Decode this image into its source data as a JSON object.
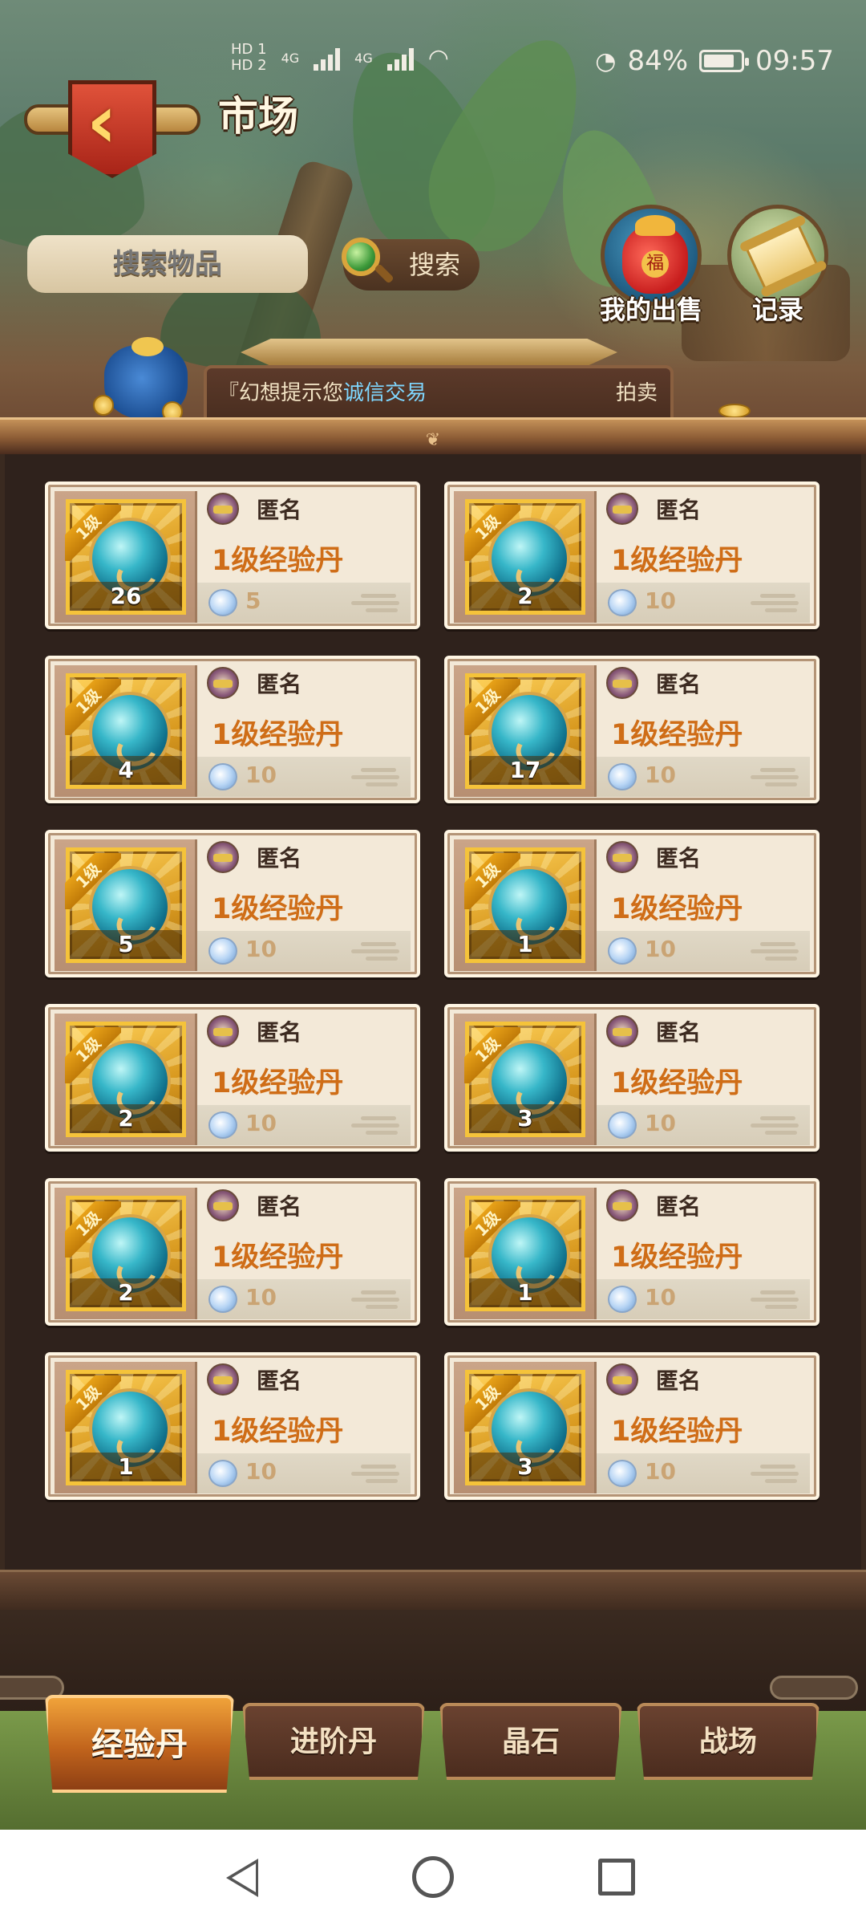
{
  "status_bar": {
    "hd1": "HD 1",
    "hd2": "HD 2",
    "net1": "4G",
    "net2": "4G",
    "battery_percent": "84%",
    "battery_level": 0.84,
    "time": "09:57"
  },
  "header": {
    "title": "市场",
    "back_icon": "chevron-left-icon"
  },
  "search": {
    "placeholder": "搜索物品",
    "button_label": "搜索"
  },
  "actions": {
    "my_sales": "我的出售",
    "records": "记录"
  },
  "notice": {
    "prefix": "『幻想提示您",
    "highlight": "诚信交易",
    "tail": "拍卖"
  },
  "items": [
    {
      "level_tag": "1级",
      "seller": "匿名",
      "name": "1级经验丹",
      "count": "26",
      "price": "5"
    },
    {
      "level_tag": "1级",
      "seller": "匿名",
      "name": "1级经验丹",
      "count": "2",
      "price": "10"
    },
    {
      "level_tag": "1级",
      "seller": "匿名",
      "name": "1级经验丹",
      "count": "4",
      "price": "10"
    },
    {
      "level_tag": "1级",
      "seller": "匿名",
      "name": "1级经验丹",
      "count": "17",
      "price": "10"
    },
    {
      "level_tag": "1级",
      "seller": "匿名",
      "name": "1级经验丹",
      "count": "5",
      "price": "10"
    },
    {
      "level_tag": "1级",
      "seller": "匿名",
      "name": "1级经验丹",
      "count": "1",
      "price": "10"
    },
    {
      "level_tag": "1级",
      "seller": "匿名",
      "name": "1级经验丹",
      "count": "2",
      "price": "10"
    },
    {
      "level_tag": "1级",
      "seller": "匿名",
      "name": "1级经验丹",
      "count": "3",
      "price": "10"
    },
    {
      "level_tag": "1级",
      "seller": "匿名",
      "name": "1级经验丹",
      "count": "2",
      "price": "10"
    },
    {
      "level_tag": "1级",
      "seller": "匿名",
      "name": "1级经验丹",
      "count": "1",
      "price": "10"
    },
    {
      "level_tag": "1级",
      "seller": "匿名",
      "name": "1级经验丹",
      "count": "1",
      "price": "10"
    },
    {
      "level_tag": "1级",
      "seller": "匿名",
      "name": "1级经验丹",
      "count": "3",
      "price": "10"
    }
  ],
  "tabs": [
    {
      "label": "经验丹",
      "active": true
    },
    {
      "label": "进阶丹",
      "active": false
    },
    {
      "label": "晶石",
      "active": false
    },
    {
      "label": "战场",
      "active": false
    }
  ],
  "colors": {
    "item_name": "#cf6d17",
    "notice_highlight": "#7fd7ff",
    "active_tab": "#f0a33a"
  }
}
